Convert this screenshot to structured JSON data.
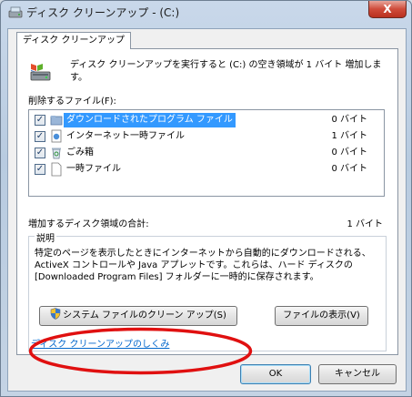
{
  "window": {
    "title": "ディスク クリーンアップ - (C:)",
    "close_label": "X"
  },
  "tab": {
    "label": "ディスク クリーンアップ"
  },
  "intro_text": "ディスク クリーンアップを実行すると (C:) の空き領域が 1 バイト 増加します。",
  "files_to_delete_label": "削除するファイル(F):",
  "files": [
    {
      "name": "ダウンロードされたプログラム ファイル",
      "size": "0 バイト",
      "checked": true,
      "selected": true,
      "icon": "folder-icon"
    },
    {
      "name": "インターネット一時ファイル",
      "size": "1 バイト",
      "checked": true,
      "selected": false,
      "icon": "internet-file-icon"
    },
    {
      "name": "ごみ箱",
      "size": "0 バイト",
      "checked": true,
      "selected": false,
      "icon": "recycle-bin-icon"
    },
    {
      "name": "一時ファイル",
      "size": "0 バイト",
      "checked": true,
      "selected": false,
      "icon": "blank-file-icon"
    }
  ],
  "total": {
    "label": "増加するディスク領域の合計:",
    "value": "1 バイト"
  },
  "description": {
    "title": "説明",
    "text": "特定のページを表示したときにインターネットから自動的にダウンロードされる、ActiveX コントロールや Java アプレットです。これらは、ハード ディスクの [Downloaded Program Files] フォルダーに一時的に保存されます。"
  },
  "buttons": {
    "system_cleanup": "システム ファイルのクリーン アップ(S)",
    "view_files": "ファイルの表示(V)",
    "ok": "OK",
    "cancel": "キャンセル"
  },
  "link_text": "ディスク クリーンアップのしくみ",
  "colors": {
    "selection": "#3399ff",
    "annotation_ellipse": "#e01010",
    "link": "#0066cc"
  }
}
